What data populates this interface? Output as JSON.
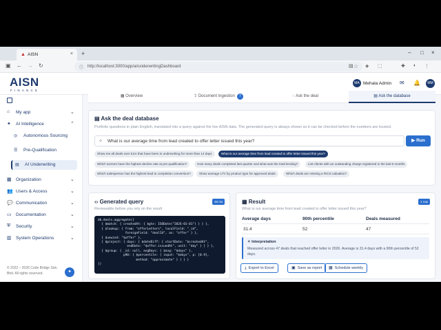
{
  "browser": {
    "tab_title": "AISN",
    "url": "http://localhost:3000/app/ai/underwritingDashboard"
  },
  "app": {
    "logo": "AISN",
    "logo_sub": "FINANCE",
    "user_initials": "MA",
    "user_name": "Mehala Admin",
    "user_initials_2": "MM"
  },
  "sidebar": {
    "my_app": "My app",
    "ai_intelligence": "AI Intelligence",
    "sub_items": [
      "Autonomous Sourcing",
      "Pre-Qualification",
      "AI Underwriting"
    ],
    "sections": [
      "Organization",
      "Users & Access",
      "Communication",
      "Documentation",
      "Security",
      "System Operations"
    ],
    "footer": "© 2022 – 2026 Code Bridge Sdn. Bhd. All rights reserved."
  },
  "tabs": {
    "overview": "Overview",
    "document_ingestion": "Document ingestion",
    "document_badge": "7",
    "ask_deal": "Ask the deal",
    "ask_database": "Ask the database"
  },
  "ask": {
    "title": "Ask the deal database",
    "subtitle": "Portfolio questions in plain English, translated into a query against the live AISN data. The generated query is always shown so it can be checked before the numbers are trusted.",
    "question": "What is our average time from lead created to offer letter issued this year?",
    "run_label": "Run",
    "suggestions": [
      "Show me all deals over £1m that have been in underwriting for more than 14 days",
      "What is our average time from lead created to offer letter issued this year?",
      "Which sectors have the highest decline rate at pre-qualification?",
      "How many deals completed last quarter and what was the total lending?",
      "List clients with an outstanding charge registered in the last 6 months",
      "Which salesperson has the highest lead to completion conversion?",
      "Show average LTV by product type for approved deals",
      "Which deals are missing a RICS valuation?"
    ]
  },
  "query": {
    "title": "Generated query",
    "subtitle": "Reviewable before you rely on the result",
    "badge": "48 ms",
    "code": "db.deals.aggregate([\n  { $match: { createdAt: { $gte: ISODate(\"2026-01-01\") } } },\n  { $lookup: { from: \"offerLetters\", localField: \"_id\",\n               foreignField: \"dealId\", as: \"offer\" } },\n  { $unwind: \"$offer\" },\n  { $project: { days: { $dateDiff: { startDate: \"$createdAt\",\n                endDate: \"$offer.issuedAt\", unit: \"day\" } } } },\n  { $group: { _id: null, avgDays: { $avg: \"$days\" },\n              p90: { $percentile: { input: \"$days\", p: [0.9],\n                     method: \"approximate\" } } } }\n])"
  },
  "result": {
    "title": "Result",
    "subtitle": "What is our average time from lead created to offer letter issued this year?",
    "badge": "1 row",
    "headers": [
      "Average days",
      "90th percentile",
      "Deals measured"
    ],
    "values": [
      "31.4",
      "52",
      "47"
    ],
    "interpretation_title": "Interpretation",
    "interpretation": "Measured across 47 deals that reached offer letter in 2026. Average is 31.4 days with a 90th percentile of 52 days.",
    "actions": [
      "Export to Excel",
      "Save as report",
      "Schedule weekly"
    ]
  }
}
